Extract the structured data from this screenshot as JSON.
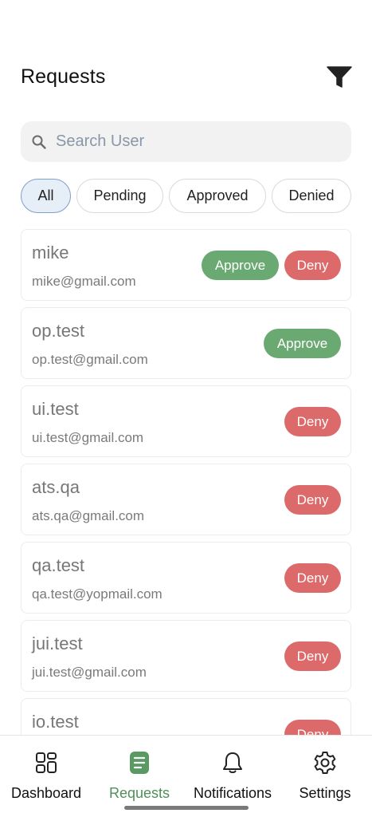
{
  "header": {
    "title": "Requests"
  },
  "search": {
    "placeholder": "Search User"
  },
  "tabs": [
    {
      "label": "All",
      "active": true
    },
    {
      "label": "Pending",
      "active": false
    },
    {
      "label": "Approved",
      "active": false
    },
    {
      "label": "Denied",
      "active": false
    }
  ],
  "actions": {
    "approve_label": "Approve",
    "deny_label": "Deny"
  },
  "requests": [
    {
      "name": "mike",
      "email": "mike@gmail.com",
      "actions": [
        "approve",
        "deny"
      ]
    },
    {
      "name": "op.test",
      "email": "op.test@gmail.com",
      "actions": [
        "approve"
      ]
    },
    {
      "name": "ui.test",
      "email": "ui.test@gmail.com",
      "actions": [
        "deny"
      ]
    },
    {
      "name": "ats.qa",
      "email": "ats.qa@gmail.com",
      "actions": [
        "deny"
      ]
    },
    {
      "name": "qa.test",
      "email": "qa.test@yopmail.com",
      "actions": [
        "deny"
      ]
    },
    {
      "name": "jui.test",
      "email": "jui.test@gmail.com",
      "actions": [
        "deny"
      ]
    },
    {
      "name": "io.test",
      "email": "",
      "actions": [
        "deny"
      ]
    }
  ],
  "nav": [
    {
      "label": "Dashboard",
      "icon": "dashboard-icon",
      "active": false
    },
    {
      "label": "Requests",
      "icon": "requests-icon",
      "active": true
    },
    {
      "label": "Notifications",
      "icon": "bell-icon",
      "active": false
    },
    {
      "label": "Settings",
      "icon": "gear-icon",
      "active": false
    }
  ],
  "colors": {
    "approve": "#6aa972",
    "deny": "#dd6a6a",
    "active_nav": "#4f8f58",
    "active_tab_bg": "#e6eef8"
  }
}
